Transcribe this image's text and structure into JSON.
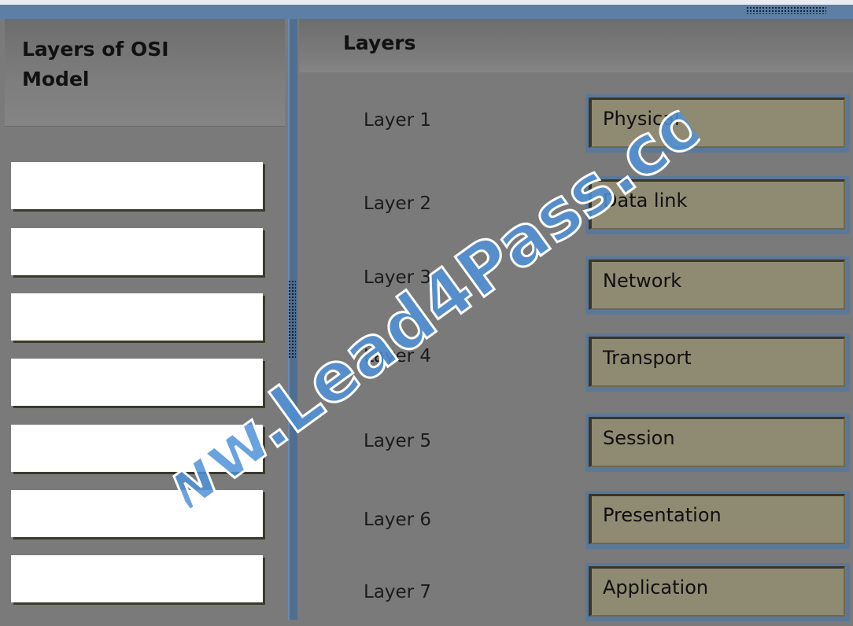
{
  "left_panel": {
    "title_line1": "Layers of OSI",
    "title_line2": "Model",
    "slots": [
      "",
      "",
      "",
      "",
      "",
      "",
      ""
    ]
  },
  "right_panel": {
    "title": "Layers",
    "layers": [
      {
        "label": "Layer 1",
        "answer": "Physical"
      },
      {
        "label": "Layer 2",
        "answer": "Data link"
      },
      {
        "label": "Layer 3",
        "answer": "Network"
      },
      {
        "label": "Layer 4",
        "answer": "Transport"
      },
      {
        "label": "Layer 5",
        "answer": "Session"
      },
      {
        "label": "Layer 6",
        "answer": "Presentation"
      },
      {
        "label": "Layer 7",
        "answer": "Application"
      }
    ]
  },
  "watermark": {
    "text": "www.Lead4Pass.com"
  },
  "colors": {
    "accent": "#5d7fa3",
    "panel_bg": "#7a7a7a",
    "answer_fill": "#8f8a72",
    "slot_fill": "#ffffff",
    "watermark_fill": "#4f92d8"
  }
}
